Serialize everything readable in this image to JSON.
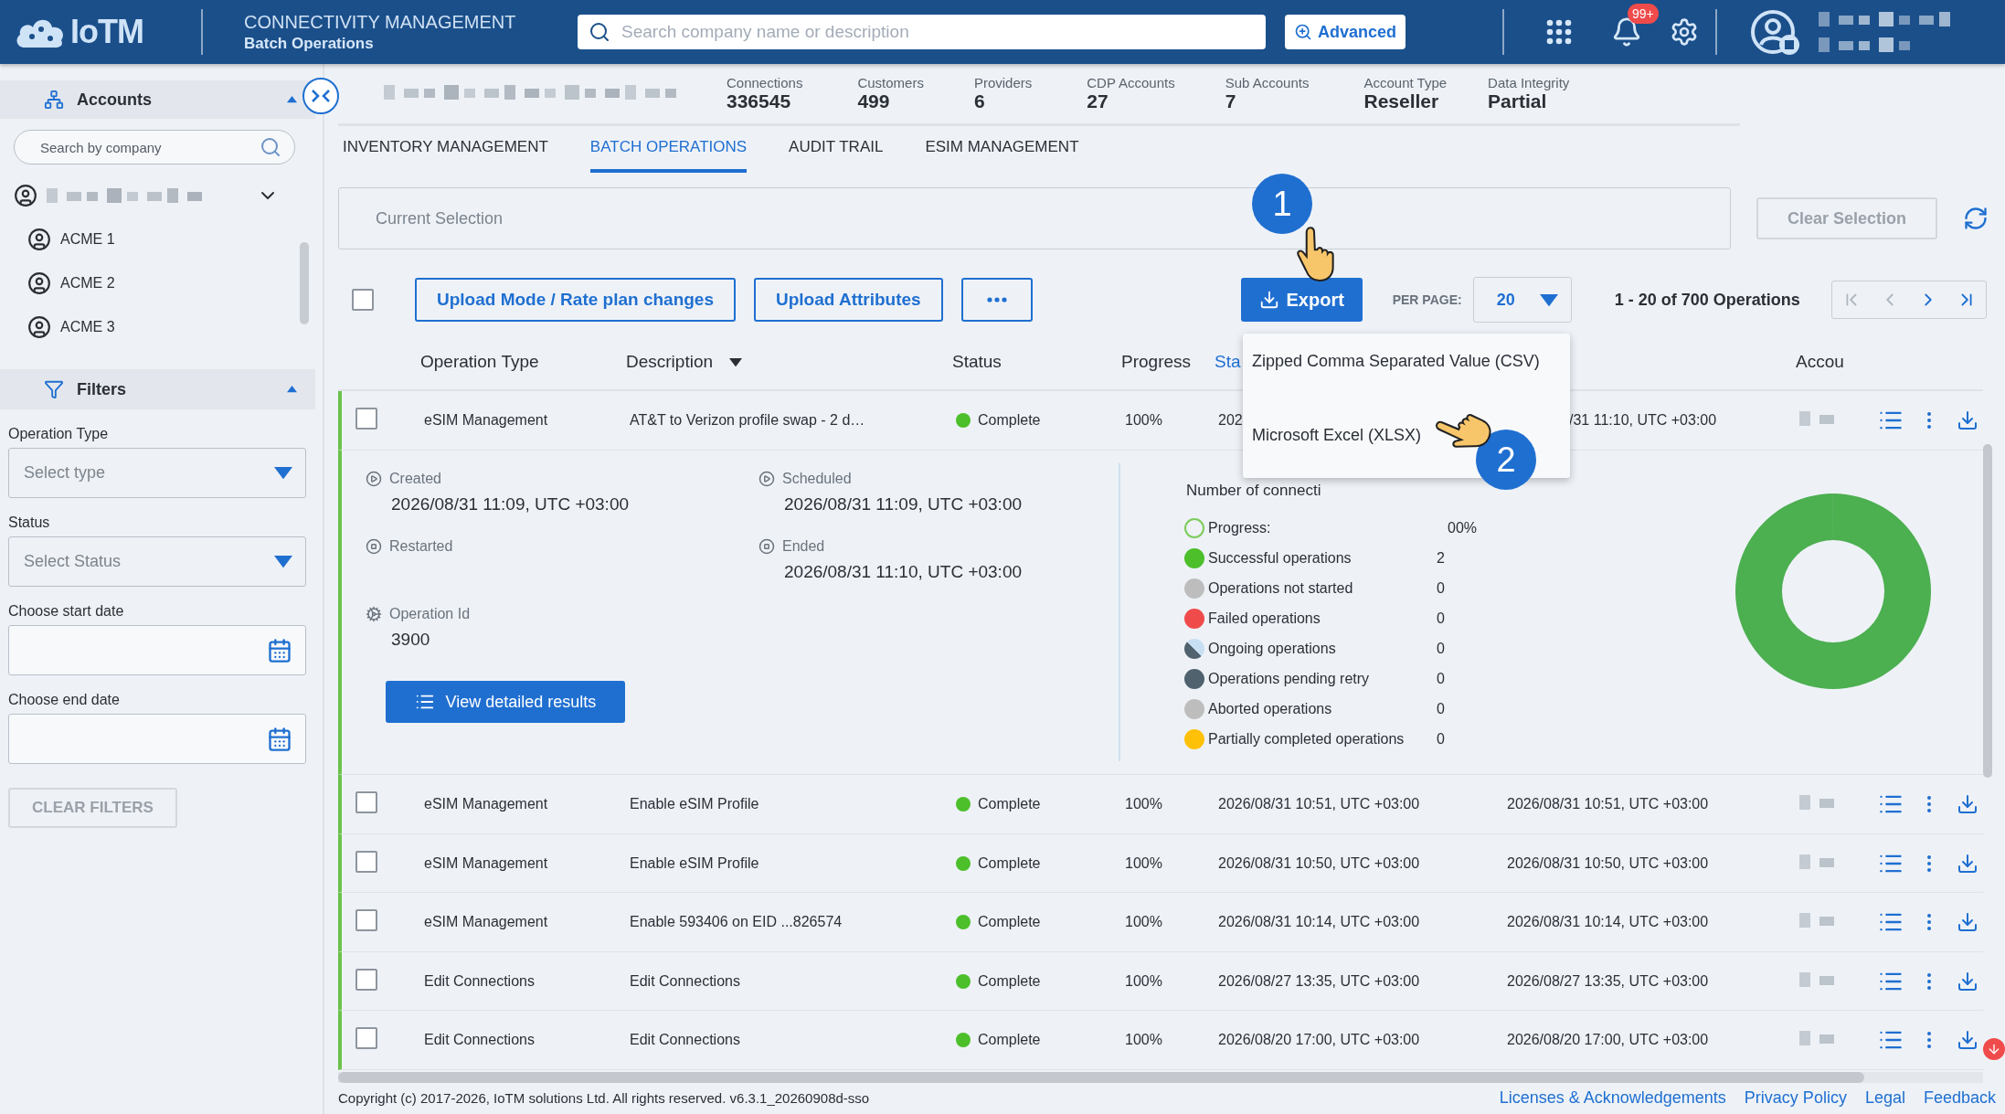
{
  "header": {
    "logo": "IoTM",
    "title": "CONNECTIVITY MANAGEMENT",
    "subtitle": "Batch Operations",
    "search": {
      "placeholder": "Search company name or description"
    },
    "advanced_button": "Advanced",
    "notification_badge": "99+"
  },
  "sidebar": {
    "accounts": {
      "title": "Accounts",
      "expanded": true,
      "search": {
        "placeholder": "Search by company"
      },
      "tree": [
        {
          "expanded": true,
          "children": [
            {
              "label": "ACME 1"
            },
            {
              "label": "ACME 2"
            },
            {
              "label": "ACME 3"
            }
          ]
        }
      ]
    },
    "filters": {
      "title": "Filters",
      "expanded": true,
      "fields": [
        {
          "kind": "select",
          "label": "Operation Type",
          "placeholder": "Select type"
        },
        {
          "kind": "select",
          "label": "Status",
          "placeholder": "Select Status"
        },
        {
          "kind": "date",
          "label": "Choose start date"
        },
        {
          "kind": "date",
          "label": "Choose end date"
        }
      ],
      "clear_button": {
        "label": "CLEAR FILTERS",
        "disabled": true
      }
    }
  },
  "stats": [
    {
      "label": "Connections",
      "value": "336545"
    },
    {
      "label": "Customers",
      "value": "499"
    },
    {
      "label": "Providers",
      "value": "6"
    },
    {
      "label": "CDP Accounts",
      "value": "27"
    },
    {
      "label": "Sub Accounts",
      "value": "7"
    },
    {
      "label": "Account Type",
      "value": "Reseller"
    },
    {
      "label": "Data Integrity",
      "value": "Partial"
    }
  ],
  "tabs": [
    {
      "label": "INVENTORY MANAGEMENT",
      "selected": false
    },
    {
      "label": "BATCH OPERATIONS",
      "selected": true
    },
    {
      "label": "AUDIT TRAIL",
      "selected": false
    },
    {
      "label": "ESIM MANAGEMENT",
      "selected": false
    }
  ],
  "selection": {
    "placeholder": "Current Selection",
    "clear_button": {
      "label": "Clear Selection",
      "disabled": true
    }
  },
  "toolbar": {
    "select_all": false,
    "buttons": [
      "Upload Mode / Rate plan changes",
      "Upload Attributes"
    ],
    "export": "Export",
    "per_page_label": "PER PAGE:",
    "per_page": "20",
    "range": "1 - 20 of 700 Operations"
  },
  "export_menu": {
    "open": true,
    "items": [
      "Zipped Comma Separated Value (CSV)",
      "Microsoft Excel (XLSX)"
    ]
  },
  "callouts": [
    "1",
    "2"
  ],
  "table": {
    "columns": [
      {
        "label": "Operation Type",
        "sorted": false
      },
      {
        "label": "Description",
        "sorted": true
      },
      {
        "label": "Status",
        "sorted": false
      },
      {
        "label": "Progress",
        "sorted": false
      },
      {
        "label": "Sta",
        "sorted": false
      },
      {
        "label": "Accou",
        "sorted": false
      }
    ],
    "rows": [
      {
        "type": "eSIM Management",
        "description": "AT&T to Verizon profile swap - 2 d…",
        "status": "Complete",
        "color": "#4cbf2a",
        "progress": "100%",
        "start": "202",
        "end": "/31 11:10, UTC +03:00",
        "checked": false,
        "expanded": true,
        "covered": true
      },
      {
        "type": "eSIM Management",
        "description": "Enable eSIM Profile",
        "status": "Complete",
        "color": "#4cbf2a",
        "progress": "100%",
        "start": "2026/08/31 10:51, UTC +03:00",
        "end": "2026/08/31 10:51, UTC +03:00",
        "checked": false,
        "expanded": false
      },
      {
        "type": "eSIM Management",
        "description": "Enable eSIM Profile",
        "status": "Complete",
        "color": "#4cbf2a",
        "progress": "100%",
        "start": "2026/08/31 10:50, UTC +03:00",
        "end": "2026/08/31 10:50, UTC +03:00",
        "checked": false,
        "expanded": false
      },
      {
        "type": "eSIM Management",
        "description": "Enable 593406 on EID ...826574",
        "status": "Complete",
        "color": "#4cbf2a",
        "progress": "100%",
        "start": "2026/08/31 10:14, UTC +03:00",
        "end": "2026/08/31 10:14, UTC +03:00",
        "checked": false,
        "expanded": false
      },
      {
        "type": "Edit Connections",
        "description": "Edit Connections",
        "status": "Complete",
        "color": "#4cbf2a",
        "progress": "100%",
        "start": "2026/08/27 13:35, UTC +03:00",
        "end": "2026/08/27 13:35, UTC +03:00",
        "checked": false,
        "expanded": false
      },
      {
        "type": "Edit Connections",
        "description": "Edit Connections",
        "status": "Complete",
        "color": "#4cbf2a",
        "progress": "100%",
        "start": "2026/08/20 17:00, UTC +03:00",
        "end": "2026/08/20 17:00, UTC +03:00",
        "checked": false,
        "expanded": false
      }
    ]
  },
  "details": {
    "times": [
      {
        "kind": "play",
        "label": "Created",
        "value": "2026/08/31 11:09, UTC +03:00"
      },
      {
        "kind": "play",
        "label": "Scheduled",
        "value": "2026/08/31 11:09, UTC +03:00"
      },
      {
        "kind": "stop",
        "label": "Restarted"
      },
      {
        "kind": "stop",
        "label": "Ended",
        "value": "2026/08/31 11:10, UTC +03:00"
      }
    ],
    "operation_id": {
      "label": "Operation Id",
      "value": "3900"
    },
    "button": "View detailed results",
    "connections": {
      "title": "Number of connecti",
      "legend": [
        {
          "kind": "ring",
          "label": "Progress:",
          "value": "00%",
          "color": "#7ccb5a"
        },
        {
          "kind": "dot",
          "label": "Successful operations",
          "value": "2",
          "color": "#4cbf2a"
        },
        {
          "kind": "dot",
          "label": "Operations not started",
          "value": "0",
          "color": "#bdbdbd"
        },
        {
          "kind": "dot",
          "label": "Failed operations",
          "value": "0",
          "color": "#f04b4b"
        },
        {
          "kind": "split",
          "label": "Ongoing operations",
          "value": "0",
          "color": "#51626f"
        },
        {
          "kind": "dot",
          "label": "Operations pending retry",
          "value": "0",
          "color": "#51626f"
        },
        {
          "kind": "dot",
          "label": "Aborted operations",
          "value": "0",
          "color": "#bdbdbd"
        },
        {
          "kind": "dot",
          "label": "Partially completed operations",
          "value": "0",
          "color": "#ffc107"
        }
      ]
    }
  },
  "footer": {
    "copyright": "Copyright (c) 2017-2026, IoTM solutions Ltd. All rights reserved. v6.3.1_20260908d-sso",
    "links": [
      "Licenses & Acknowledgements",
      "Privacy Policy",
      "Legal",
      "Feedback"
    ]
  }
}
